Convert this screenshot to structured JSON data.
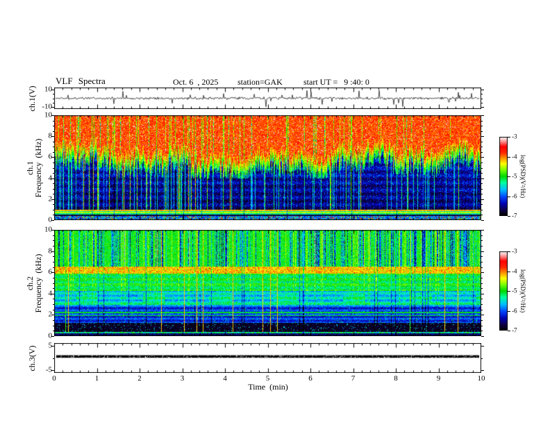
{
  "title": {
    "main": "VLF Spectra",
    "date": "Oct. 6  , 2025",
    "station": "station=GAK",
    "start_ut": "start UT =   9 :40: 0"
  },
  "x_axis": {
    "label": "Time  (min)",
    "ticks": [
      "0",
      "1",
      "2",
      "3",
      "4",
      "5",
      "6",
      "7",
      "8",
      "9",
      "10"
    ],
    "minor_per_major": 5
  },
  "panels": {
    "ch1_wave": {
      "ylabel": "ch.1(V)",
      "yticks": [
        "10",
        "-10"
      ],
      "ytick_values": [
        10,
        -10
      ],
      "range": [
        -12,
        12
      ]
    },
    "ch1_spec": {
      "ylabel_line1": "ch.1",
      "ylabel_line2": "Frequency  (kHz)",
      "yticks": [
        "0",
        "2",
        "4",
        "6",
        "8",
        "10"
      ]
    },
    "ch2_spec": {
      "ylabel_line1": "ch.2",
      "ylabel_line2": "Frequency  (kHz)",
      "yticks": [
        "0",
        "2",
        "4",
        "6",
        "8",
        "10"
      ]
    },
    "ch3_wave": {
      "ylabel": "ch.3(V)",
      "yticks": [
        "5",
        "-5"
      ],
      "ytick_values": [
        5,
        -5
      ],
      "range": [
        -6,
        6
      ]
    }
  },
  "colorbar": {
    "unit": "log(PSD)(V²/Hz)",
    "ticks": [
      "-3",
      "-4",
      "-5",
      "-6",
      "-7"
    ],
    "range": [
      -7,
      -3
    ]
  },
  "chart_data": [
    {
      "type": "line",
      "panel": "ch1 waveform",
      "ylabel": "ch.1(V)",
      "ylim": [
        -12,
        12
      ],
      "yticks": [
        10,
        -10
      ],
      "x_minutes": [
        0,
        10
      ],
      "signal": {
        "baseline_V": 0,
        "noise_amp_V": 1,
        "spike_amp_V": [
          3,
          10
        ],
        "note": "continuous broadband noise trace with frequent impulsive spikes of both polarities reaching ±10 V"
      }
    },
    {
      "type": "heatmap",
      "panel": "ch1 spectrogram",
      "xlabel": "Time (min)",
      "ylabel": "ch.1 Frequency (kHz)",
      "xlim": [
        0,
        10
      ],
      "ylim": [
        0,
        10
      ],
      "scale": "log(PSD)(V²/Hz)",
      "value_range": [
        -7,
        -3
      ],
      "features": {
        "red_top": {
          "boundary_khz_range": [
            4.9,
            7.5
          ],
          "psd": -3.55,
          "note": "intense red/orange region above a flame-like lower edge"
        },
        "transition_psd": -4.7,
        "low_region": {
          "f": [
            1.05,
            5.0
          ],
          "psd": -6.5,
          "note": "dark blue/black with dense vertical sferic streaks"
        },
        "sferic_streaks": {
          "density": 0.18,
          "psd_boost": [
            0.6,
            2.6
          ]
        },
        "narrowband_lines": [
          {
            "f": 0.95,
            "psd": -3.9
          },
          {
            "f": 0.85,
            "psd": -5.1
          },
          {
            "f": 0.74,
            "psd": -4.3
          },
          {
            "f": 0.62,
            "psd": -5.0
          }
        ],
        "dark_gap": {
          "f": [
            0.44,
            0.56
          ],
          "psd": -6.6
        },
        "bottom_speckle": {
          "f": [
            0,
            0.44
          ],
          "psd": -5.8
        }
      }
    },
    {
      "type": "heatmap",
      "panel": "ch2 spectrogram",
      "xlabel": "Time (min)",
      "ylabel": "ch.2 Frequency (kHz)",
      "xlim": [
        0,
        10
      ],
      "ylim": [
        0,
        10
      ],
      "scale": "log(PSD)(V²/Hz)",
      "value_range": [
        -7,
        -3
      ],
      "features": {
        "green_top": {
          "f": [
            6.55,
            10
          ],
          "psd": -5.0,
          "dark_streak_density": 0.28,
          "note": "green/cyan with dark blue vertical stripes"
        },
        "yellow_band": {
          "f": [
            5.9,
            6.55
          ],
          "psd": -4.2,
          "note": "bright yellow/orange horizontal band near 6 kHz"
        },
        "cyan_mid": {
          "f": [
            4.3,
            5.9
          ],
          "psd": -5.1
        },
        "blue_patches": {
          "f": [
            2.85,
            4.3
          ],
          "psd": -5.6
        },
        "navy_band": {
          "f": [
            1.25,
            2.85
          ],
          "psd": -6.15
        },
        "dark_low": {
          "f": [
            0.4,
            1.25
          ],
          "psd": -6.7
        },
        "bottom_speckle": {
          "f": [
            0,
            0.4
          ],
          "psd": -6.0
        },
        "red_vertical_lines": {
          "density": 0.03,
          "psd": -4.2,
          "note": "thin full-height orange/red sferic lines"
        }
      }
    },
    {
      "type": "line",
      "panel": "ch3 waveform",
      "ylabel": "ch.3(V)",
      "ylim": [
        -6,
        6
      ],
      "yticks": [
        5,
        -5
      ],
      "signal": {
        "baseline_V": 0.6,
        "noise_amp_V": 0.05,
        "note": "flat thick black trace, no activity"
      }
    }
  ]
}
